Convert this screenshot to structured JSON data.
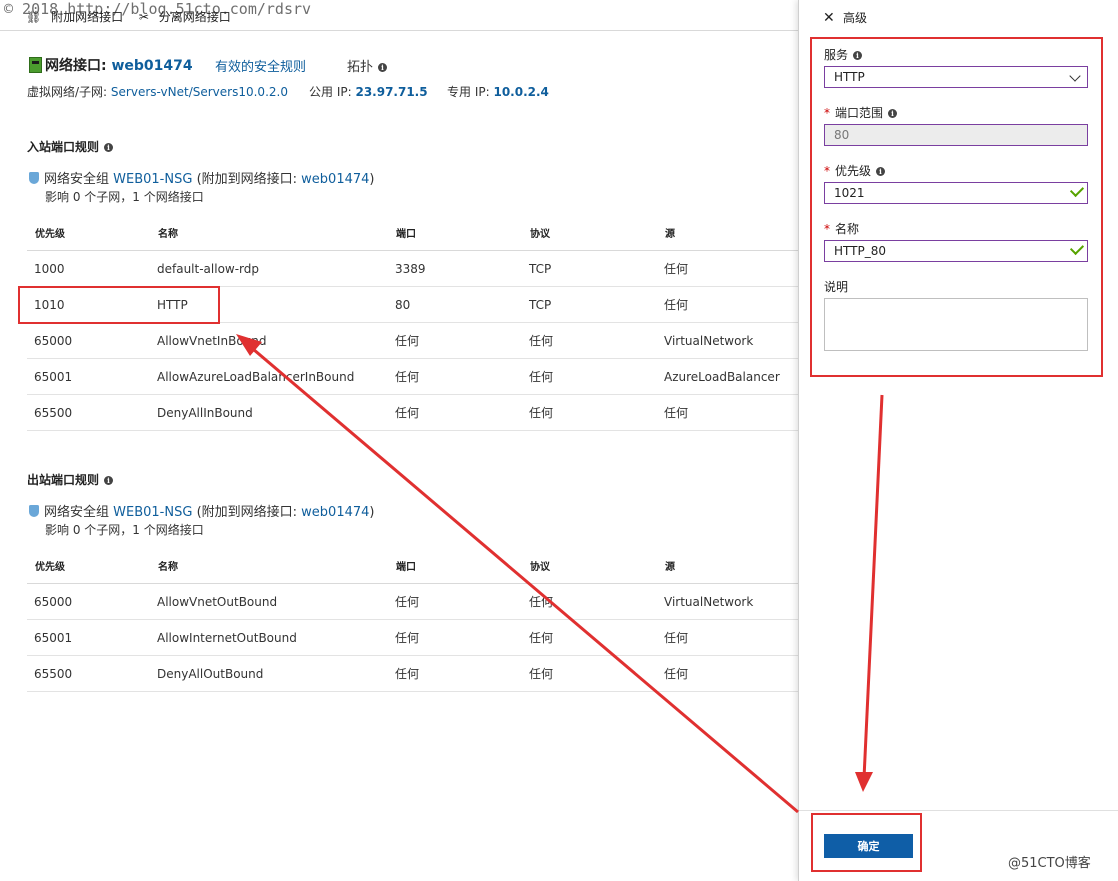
{
  "watermark": "© 2018 http://blog.51cto.com/rdsrv",
  "toolbar": {
    "attach": "附加网络接口",
    "detach": "分离网络接口"
  },
  "header": {
    "nic_label": "网络接口:",
    "nic_name": "web01474",
    "effective_rules": "有效的安全规则",
    "topology": "拓扑",
    "vnet_label": "虚拟网络/子网:",
    "vnet_value": "Servers-vNet/Servers10.0.2.0",
    "public_ip_label": "公用 IP:",
    "public_ip": "23.97.71.5",
    "private_ip_label": "专用 IP:",
    "private_ip": "10.0.2.4"
  },
  "inbound": {
    "title": "入站端口规则",
    "nsg_prefix": "网络安全组",
    "nsg_name": "WEB01-NSG",
    "nsg_mid": "(附加到网络接口:",
    "nsg_nic": "web01474",
    "nsg_suffix": ")",
    "affect": "影响 0 个子网，1 个网络接口",
    "columns": [
      "优先级",
      "名称",
      "端口",
      "协议",
      "源"
    ],
    "rows": [
      [
        "1000",
        "default-allow-rdp",
        "3389",
        "TCP",
        "任何"
      ],
      [
        "1010",
        "HTTP",
        "80",
        "TCP",
        "任何"
      ],
      [
        "65000",
        "AllowVnetInBound",
        "任何",
        "任何",
        "VirtualNetwork"
      ],
      [
        "65001",
        "AllowAzureLoadBalancerInBound",
        "任何",
        "任何",
        "AzureLoadBalancer"
      ],
      [
        "65500",
        "DenyAllInBound",
        "任何",
        "任何",
        "任何"
      ]
    ]
  },
  "outbound": {
    "title": "出站端口规则",
    "nsg_prefix": "网络安全组",
    "nsg_name": "WEB01-NSG",
    "nsg_mid": "(附加到网络接口:",
    "nsg_nic": "web01474",
    "nsg_suffix": ")",
    "affect": "影响 0 个子网，1 个网络接口",
    "columns": [
      "优先级",
      "名称",
      "端口",
      "协议",
      "源"
    ],
    "rows": [
      [
        "65000",
        "AllowVnetOutBound",
        "任何",
        "任何",
        "VirtualNetwork"
      ],
      [
        "65001",
        "AllowInternetOutBound",
        "任何",
        "任何",
        "任何"
      ],
      [
        "65500",
        "DenyAllOutBound",
        "任何",
        "任何",
        "任何"
      ]
    ]
  },
  "blade": {
    "advanced": "高级",
    "service_label": "服务",
    "service_value": "HTTP",
    "port_label": "端口范围",
    "port_value": "80",
    "priority_label": "优先级",
    "priority_value": "1021",
    "name_label": "名称",
    "name_value": "HTTP_80",
    "desc_label": "说明",
    "ok_label": "确定"
  },
  "brand": "@51CTO博客",
  "colors": {
    "accent": "#0f5e9c",
    "highlight": "#e03030",
    "valid": "#57a300",
    "field_border": "#7a3fa0"
  }
}
